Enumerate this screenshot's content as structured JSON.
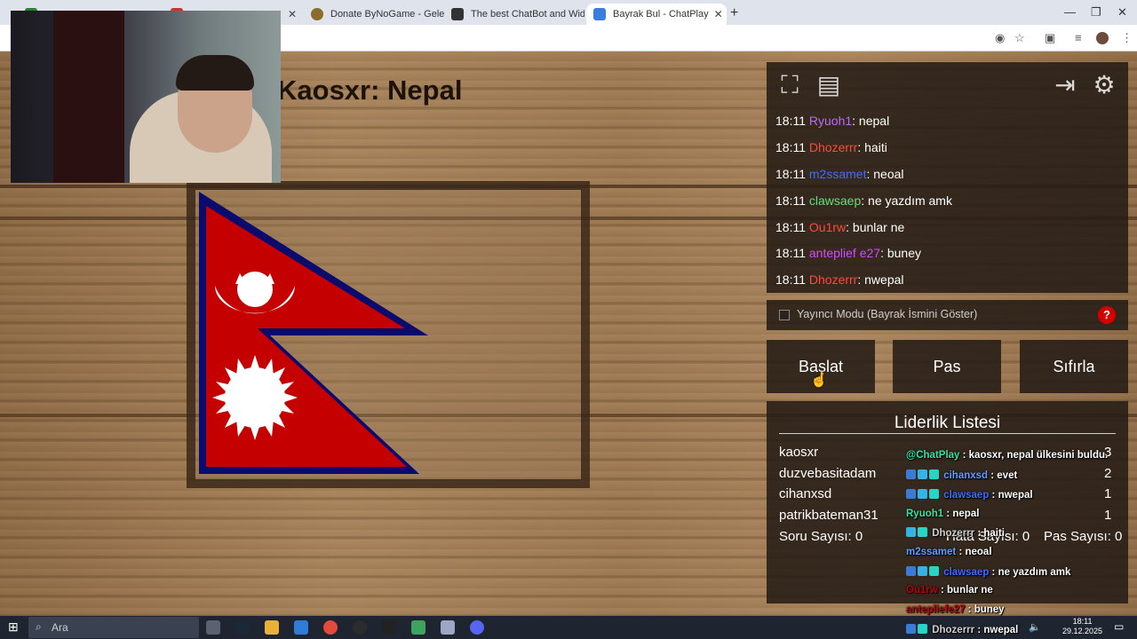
{
  "browser": {
    "tabs": [
      {
        "label": "",
        "color": "#2e7d32"
      },
      {
        "label": "",
        "color": "#d32f2f"
      },
      {
        "label": "Donate ByNoGame - Gelen/Gid",
        "color": "#555555"
      },
      {
        "label": "The best ChatBot and Widgets",
        "color": "#333333"
      },
      {
        "label": "Bayrak Bul - ChatPlay",
        "color": "#3b7ddd"
      }
    ],
    "new_tab": "+",
    "minimize": "—",
    "maximize": "❐",
    "close": "✕"
  },
  "game": {
    "title": "Kaosxr: Nepal",
    "flag_country": "Nepal"
  },
  "chat": {
    "messages": [
      {
        "time": "18:11",
        "user": "Ryuoh1",
        "color": "#b96cf0",
        "text": ": nepal"
      },
      {
        "time": "18:11",
        "user": "Dhozerrr",
        "color": "#ff4a3d",
        "text": ": haiti"
      },
      {
        "time": "18:11",
        "user": "m2ssamet",
        "color": "#3f6dff",
        "text": ": neoal"
      },
      {
        "time": "18:11",
        "user": "clawsaep",
        "color": "#5fe07a",
        "text": ": ne yazdım amk"
      },
      {
        "time": "18:11",
        "user": "Ou1rw",
        "color": "#ff4a3d",
        "text": ": bunlar ne"
      },
      {
        "time": "18:11",
        "user": "anteplief e27",
        "color": "#d14bff",
        "text": ": buney"
      },
      {
        "time": "18:11",
        "user": "Dhozerrr",
        "color": "#ff4a3d",
        "text": ": nwepal"
      }
    ],
    "icons": [
      "fullscreen-icon",
      "document-icon",
      "exit-icon",
      "gear-icon"
    ]
  },
  "mode": {
    "label": "Yayıncı Modu (Bayrak İsmini Göster)",
    "help": "?"
  },
  "buttons": {
    "start": "Başlat",
    "pass": "Pas",
    "reset": "Sıfırla"
  },
  "leaderboard": {
    "title": "Liderlik Listesi",
    "entries": [
      {
        "name": "kaosxr",
        "score": "3"
      },
      {
        "name": "duzvebasitadam",
        "score": "2"
      },
      {
        "name": "cihanxsd",
        "score": "1"
      },
      {
        "name": "patrikbateman31",
        "score": "1"
      }
    ],
    "question_count": "Soru Sayısı: 0",
    "error_count": "Hata Sayısı: 0",
    "pass_count": "Pas Sayısı: 0"
  },
  "overlay_chat": [
    {
      "user": "@ChatPlay",
      "color": "#2ee6a6",
      "text": " : kaosxr, nepal ülkesini buldu."
    },
    {
      "user": "cihanxsd",
      "color": "#5aa0ff",
      "text": " : evet"
    },
    {
      "user": "clawsaep",
      "color": "#3f6dff",
      "text": " : nwepal"
    },
    {
      "user": "Ryuoh1",
      "color": "#2ee6a6",
      "text": " : nepal"
    },
    {
      "user": "Dhozerrr",
      "color": "#cfcfcf",
      "text": " : haiti"
    },
    {
      "user": "m2ssamet",
      "color": "#5aa0ff",
      "text": " : neoal"
    },
    {
      "user": "clawsaep",
      "color": "#3f6dff",
      "text": " : ne yazdım amk"
    },
    {
      "user": "Ou1rw",
      "color": "#c0000a",
      "text": " : bunlar ne"
    },
    {
      "user": "antepliefe27",
      "color": "#c0000a",
      "text": " : buney"
    },
    {
      "user": "Dhozerrr",
      "color": "#cfcfcf",
      "text": " : nwepal"
    }
  ],
  "taskbar": {
    "search_placeholder": "Ara",
    "time": "18:11",
    "date": "29.12.2025"
  }
}
